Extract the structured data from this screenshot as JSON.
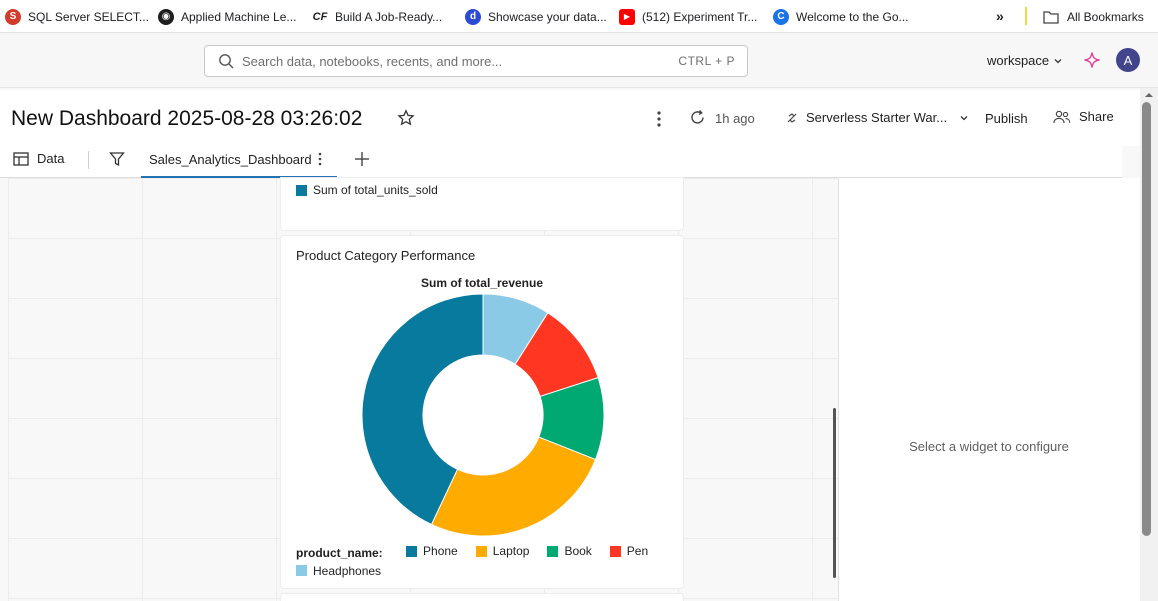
{
  "bookmarks": {
    "items": [
      {
        "label": "SQL Server SELECT...",
        "icon": "sqlserver-favicon",
        "color": "#d33b2c"
      },
      {
        "label": "Applied Machine Le...",
        "icon": "globe-favicon",
        "color": "#1f1f1f"
      },
      {
        "label": "Build A Job-Ready...",
        "icon": "cf-favicon",
        "color": "#1f1f1f"
      },
      {
        "label": "Showcase your data...",
        "icon": "d-favicon",
        "color": "#2d4ad6"
      },
      {
        "label": "(512) Experiment Tr...",
        "icon": "youtube-favicon",
        "color": "#ff0000"
      },
      {
        "label": "Welcome to the Go...",
        "icon": "c-favicon",
        "color": "#1a73e8"
      }
    ],
    "more": "»",
    "all_bookmarks": "All Bookmarks"
  },
  "header": {
    "search_placeholder": "Search data, notebooks, recents, and more...",
    "search_shortcut": "CTRL + P",
    "workspace": "workspace",
    "avatar_initial": "A"
  },
  "dashboard": {
    "title": "New Dashboard 2025-08-28 03:26:02",
    "refreshed": "1h ago",
    "warehouse": "Serverless Starter War...",
    "publish": "Publish",
    "share": "Share"
  },
  "tabs": {
    "data": "Data",
    "active": "Sales_Analytics_Dashboard"
  },
  "widgets": {
    "prev_legend": {
      "label": "Sum of total_units_sold",
      "color": "#077a9d"
    },
    "category": {
      "title": "Product Category Performance",
      "legend_title": "product_name:"
    }
  },
  "right_panel": {
    "message": "Select a widget to configure"
  },
  "chart_data": {
    "type": "pie",
    "title": "Sum of total_revenue",
    "legend_title": "product_name:",
    "legend_placement": "bottom",
    "donut": true,
    "categories": [
      "Phone",
      "Laptop",
      "Book",
      "Pen",
      "Headphones"
    ],
    "values": [
      43,
      26,
      11,
      11,
      9
    ],
    "colors": [
      "#077a9d",
      "#ffab00",
      "#00a972",
      "#ff3621",
      "#8bcae7"
    ]
  }
}
